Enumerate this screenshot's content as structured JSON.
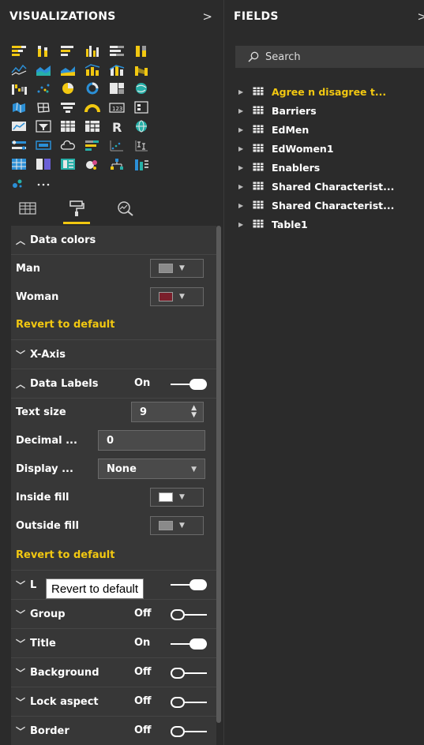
{
  "viz_pane": {
    "title": "VISUALIZATIONS",
    "chevron": ">",
    "more_label": "···"
  },
  "format_tabs": [
    "fields-tab",
    "format-tab",
    "analytics-tab"
  ],
  "format": {
    "data_colors": {
      "header": "Data colors",
      "man_label": "Man",
      "man_color": "#8a8a8a",
      "woman_label": "Woman",
      "woman_color": "#7a1f2b",
      "revert": "Revert to default"
    },
    "x_axis": {
      "header": "X-Axis"
    },
    "data_labels": {
      "header": "Data Labels",
      "state": "On",
      "text_size_label": "Text size",
      "text_size_value": "9",
      "decimal_label": "Decimal ...",
      "decimal_value": "0",
      "display_label": "Display ...",
      "display_value": "None",
      "inside_fill_label": "Inside fill",
      "inside_fill_color": "#ffffff",
      "outside_fill_label": "Outside fill",
      "outside_fill_color": "#8a8a8a",
      "revert": "Revert to default"
    },
    "hidden_section": {
      "header": "L"
    },
    "group": {
      "header": "Group",
      "state": "Off"
    },
    "title": {
      "header": "Title",
      "state": "On"
    },
    "background": {
      "header": "Background",
      "state": "Off"
    },
    "lock_aspect": {
      "header": "Lock aspect",
      "state": "Off"
    },
    "border": {
      "header": "Border",
      "state": "Off"
    }
  },
  "tooltip": "Revert to default",
  "fields_pane": {
    "title": "FIELDS",
    "chevron": ">",
    "search_placeholder": "Search",
    "tables": [
      "Agree n disagree t...",
      "Barriers",
      "EdMen",
      "EdWomen1",
      "Enablers",
      "Shared Characterist...",
      "Shared Characterist...",
      "Table1"
    ]
  },
  "colors": {
    "accent": "#f2c811",
    "pane_bg": "#2b2b2b",
    "section_bg": "#373737"
  }
}
